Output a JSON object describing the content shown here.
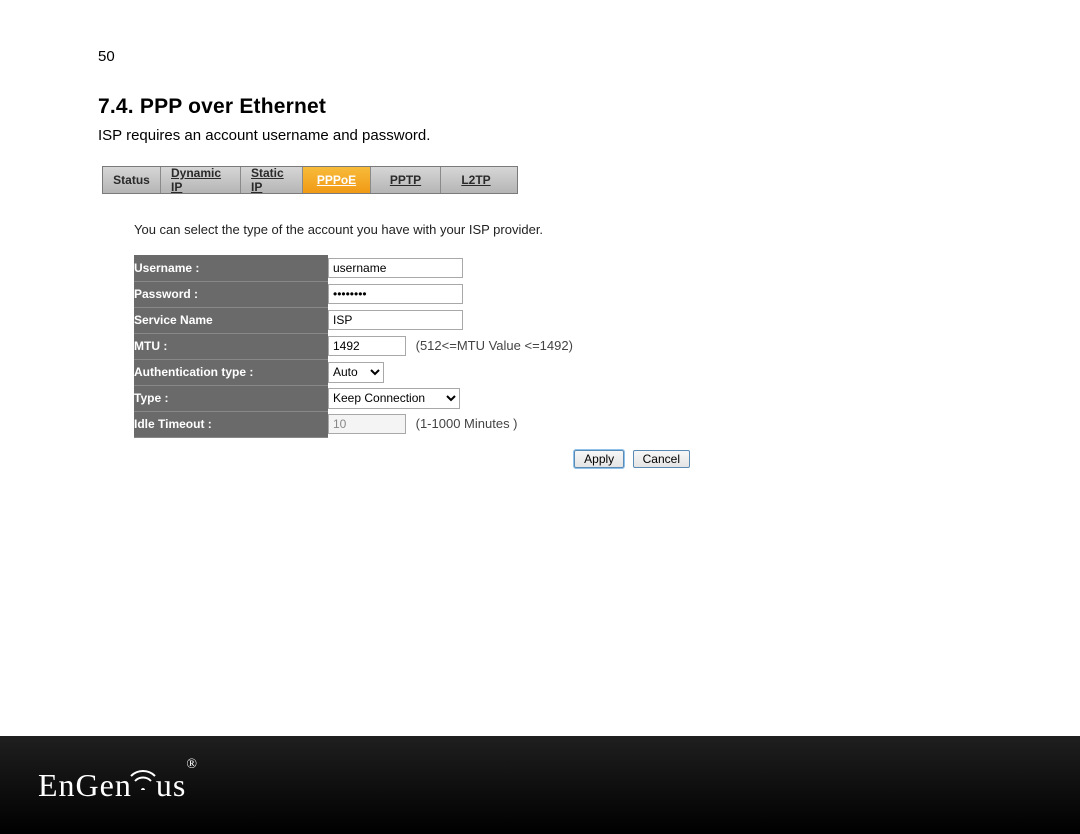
{
  "page_number": "50",
  "heading": "7.4. PPP over Ethernet",
  "subtext": "ISP requires an account username and password.",
  "tabs": {
    "status": "Status",
    "dynamic": "Dynamic IP",
    "static": "Static IP",
    "pppoe": "PPPoE",
    "pptp": "PPTP",
    "l2tp": "L2TP"
  },
  "instruction": "You can select the type of the account you have with your ISP provider.",
  "form": {
    "username_label": "Username :",
    "username_value": "username",
    "password_label": "Password :",
    "password_value": "••••••••",
    "service_label": "Service Name",
    "service_value": "ISP",
    "mtu_label": "MTU :",
    "mtu_value": "1492",
    "mtu_hint": "(512<=MTU Value <=1492)",
    "auth_label": "Authentication type :",
    "auth_value": "Auto",
    "type_label": "Type :",
    "type_value": "Keep Connection",
    "idle_label": "Idle Timeout :",
    "idle_value": "10",
    "idle_hint": "(1-1000 Minutes )"
  },
  "buttons": {
    "apply": "Apply",
    "cancel": "Cancel"
  },
  "brand": {
    "name_a": "En",
    "name_b": "Gen",
    "name_c": "us",
    "reg": "®"
  }
}
